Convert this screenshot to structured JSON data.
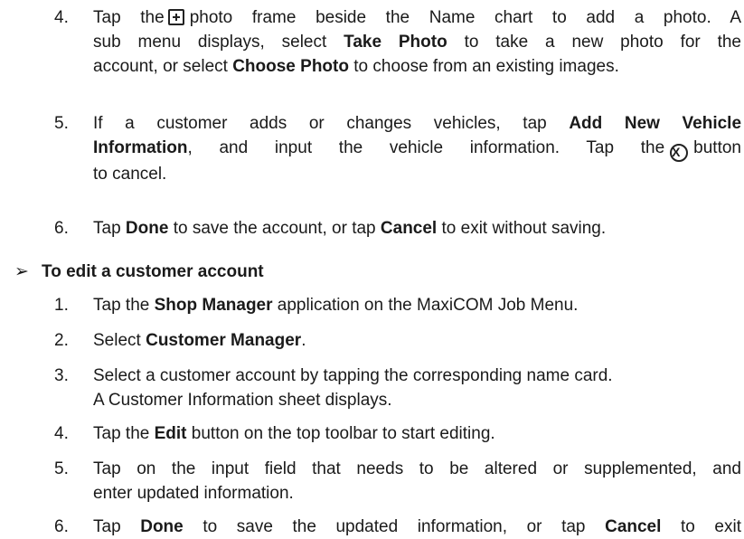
{
  "steps_before": [
    {
      "num": "4.",
      "l1_a": "Tap the",
      "l1_b": "photo frame beside the Name chart to add a photo. A",
      "l2_a": "sub menu displays, select",
      "l2_b": "Take Photo",
      "l2_c": "to take a new photo for the",
      "l3_a": "account, or select",
      "l3_b": "Choose Photo",
      "l3_c": "to choose from an existing images."
    },
    {
      "num": "5.",
      "l1_a": "If a customer adds or changes vehicles, tap",
      "l1_b": "Add New Vehicle",
      "l2_a": "Information",
      "l2_b": ", and input the vehicle information. Tap the",
      "l2_c": "button",
      "l3_a": "to cancel."
    },
    {
      "num": "6.",
      "a": "Tap",
      "b": "Done",
      "c": "to save the account, or tap",
      "d": "Cancel",
      "e": "to exit without saving."
    }
  ],
  "section": {
    "arrow": "➢",
    "title": "To edit a customer account"
  },
  "steps_edit": [
    {
      "num": "1.",
      "a": "Tap the",
      "b": "Shop Manager",
      "c": "application on the MaxiCOM Job Menu."
    },
    {
      "num": "2.",
      "a": "Select",
      "b": "Customer Manager",
      "c": "."
    },
    {
      "num": "3.",
      "l1": "Select a customer account by tapping the corresponding name card.",
      "l2": "A Customer Information sheet displays."
    },
    {
      "num": "4.",
      "a": "Tap the",
      "b": "Edit",
      "c": "button on the top toolbar to start editing."
    },
    {
      "num": "5.",
      "l1": "Tap on the input field that needs to be altered or supplemented, and",
      "l2": "enter updated information."
    },
    {
      "num": "6.",
      "a": "Tap",
      "b": "Done",
      "c": "to save the updated information, or tap",
      "d": "Cancel",
      "e": "to exit"
    }
  ],
  "icons": {
    "photo_frame": "plus-square-icon",
    "cancel": "circle-x-icon",
    "cancel_glyph": "X"
  }
}
